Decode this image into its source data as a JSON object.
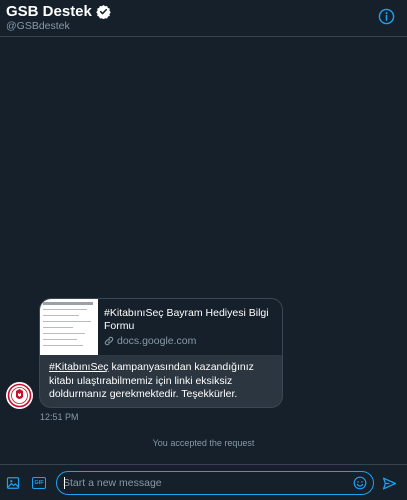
{
  "header": {
    "name": "GSB Destek",
    "handle": "@GSBdestek",
    "verified_icon": "verified-badge-icon",
    "info_icon": "info-icon"
  },
  "message": {
    "card": {
      "title": "#KitabınıSeç Bayram Hediyesi Bilgi Formu",
      "domain": "docs.google.com",
      "link_icon": "link-icon",
      "thumbnail_heading": "#KitabınıSeç Bayram Hediyesi Bilgi Formu"
    },
    "body_hashtag": "#KitabınıSeç",
    "body_text": " kampanyasından kazandığınız kitabı ulaştırabilmemiz için linki eksiksiz doldurmanız gerekmektedir. Teşekkürler.",
    "timestamp": "12:51 PM"
  },
  "status": {
    "accepted_text": "You accepted the request"
  },
  "composer": {
    "placeholder": "Start a new message",
    "value": "",
    "gif_label": "GIF",
    "media_icon": "image-icon",
    "emoji_icon": "emoji-icon",
    "send_icon": "send-icon"
  },
  "colors": {
    "background": "#15202b",
    "accent": "#1da1f2",
    "muted_text": "#8899a6",
    "card_background": "#2c3640",
    "avatar_red": "#c8102e"
  }
}
